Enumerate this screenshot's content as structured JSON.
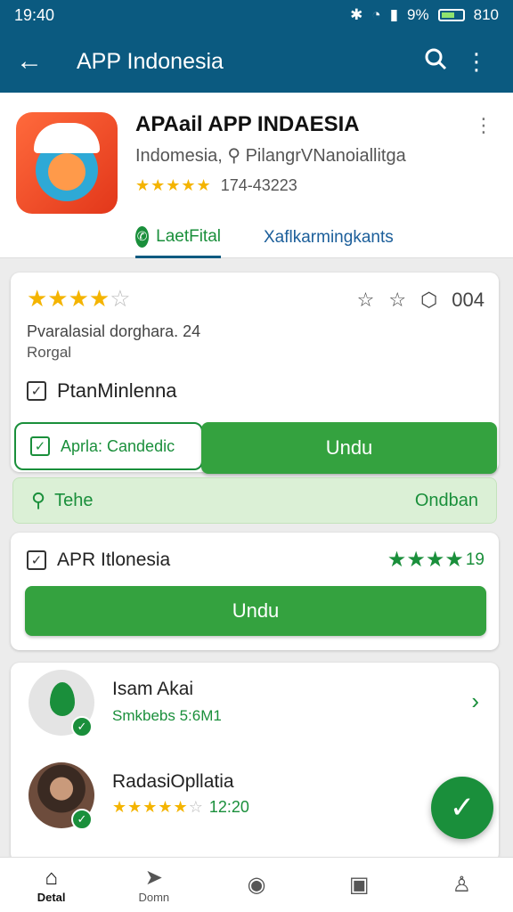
{
  "status_bar": {
    "time": "19:40",
    "battery": "9%",
    "clock_right": "810"
  },
  "app_bar": {
    "title": "APP Indonesia"
  },
  "app_header": {
    "name": "APAail APP INDAESIA",
    "subtitle": "Indomesia,  ⚲ PilangrVNanoiallitga",
    "stars": "★★★★★",
    "rating_text": "174-43223",
    "tabs": [
      "LaetFital",
      "Xaflkarmingkants"
    ]
  },
  "review_card": {
    "stars_filled": "★★★★",
    "stars_empty": "☆",
    "count": "004",
    "line1": "Pvaralasial dorghara.   24",
    "line2": "Rorgal",
    "check_label": "PtanMinlenna",
    "outline_button": "Aprla: Candedic",
    "download_button": "Undu"
  },
  "notice": {
    "left": "Tehe",
    "right": "Ondban"
  },
  "app_card": {
    "name": "APR Itlonesia",
    "stars": "★★★★",
    "count": "19",
    "download_button": "Undu"
  },
  "list": [
    {
      "name": "Isam Akai",
      "sub": "Smkbebs 5:6M1"
    },
    {
      "name": "RadasiOpllatia",
      "stars_filled": "★★★★★",
      "stars_empty": "☆",
      "sub": "12:20"
    }
  ],
  "bottom_nav": [
    {
      "label": "Detal",
      "icon": "home-icon"
    },
    {
      "label": "Domn",
      "icon": "send-icon"
    },
    {
      "label": "",
      "icon": "compass-icon"
    },
    {
      "label": "",
      "icon": "video-icon"
    },
    {
      "label": "",
      "icon": "profile-icon"
    }
  ],
  "colors": {
    "primary": "#0b5a80",
    "green": "#1a8f3b",
    "star": "#f4b400"
  }
}
